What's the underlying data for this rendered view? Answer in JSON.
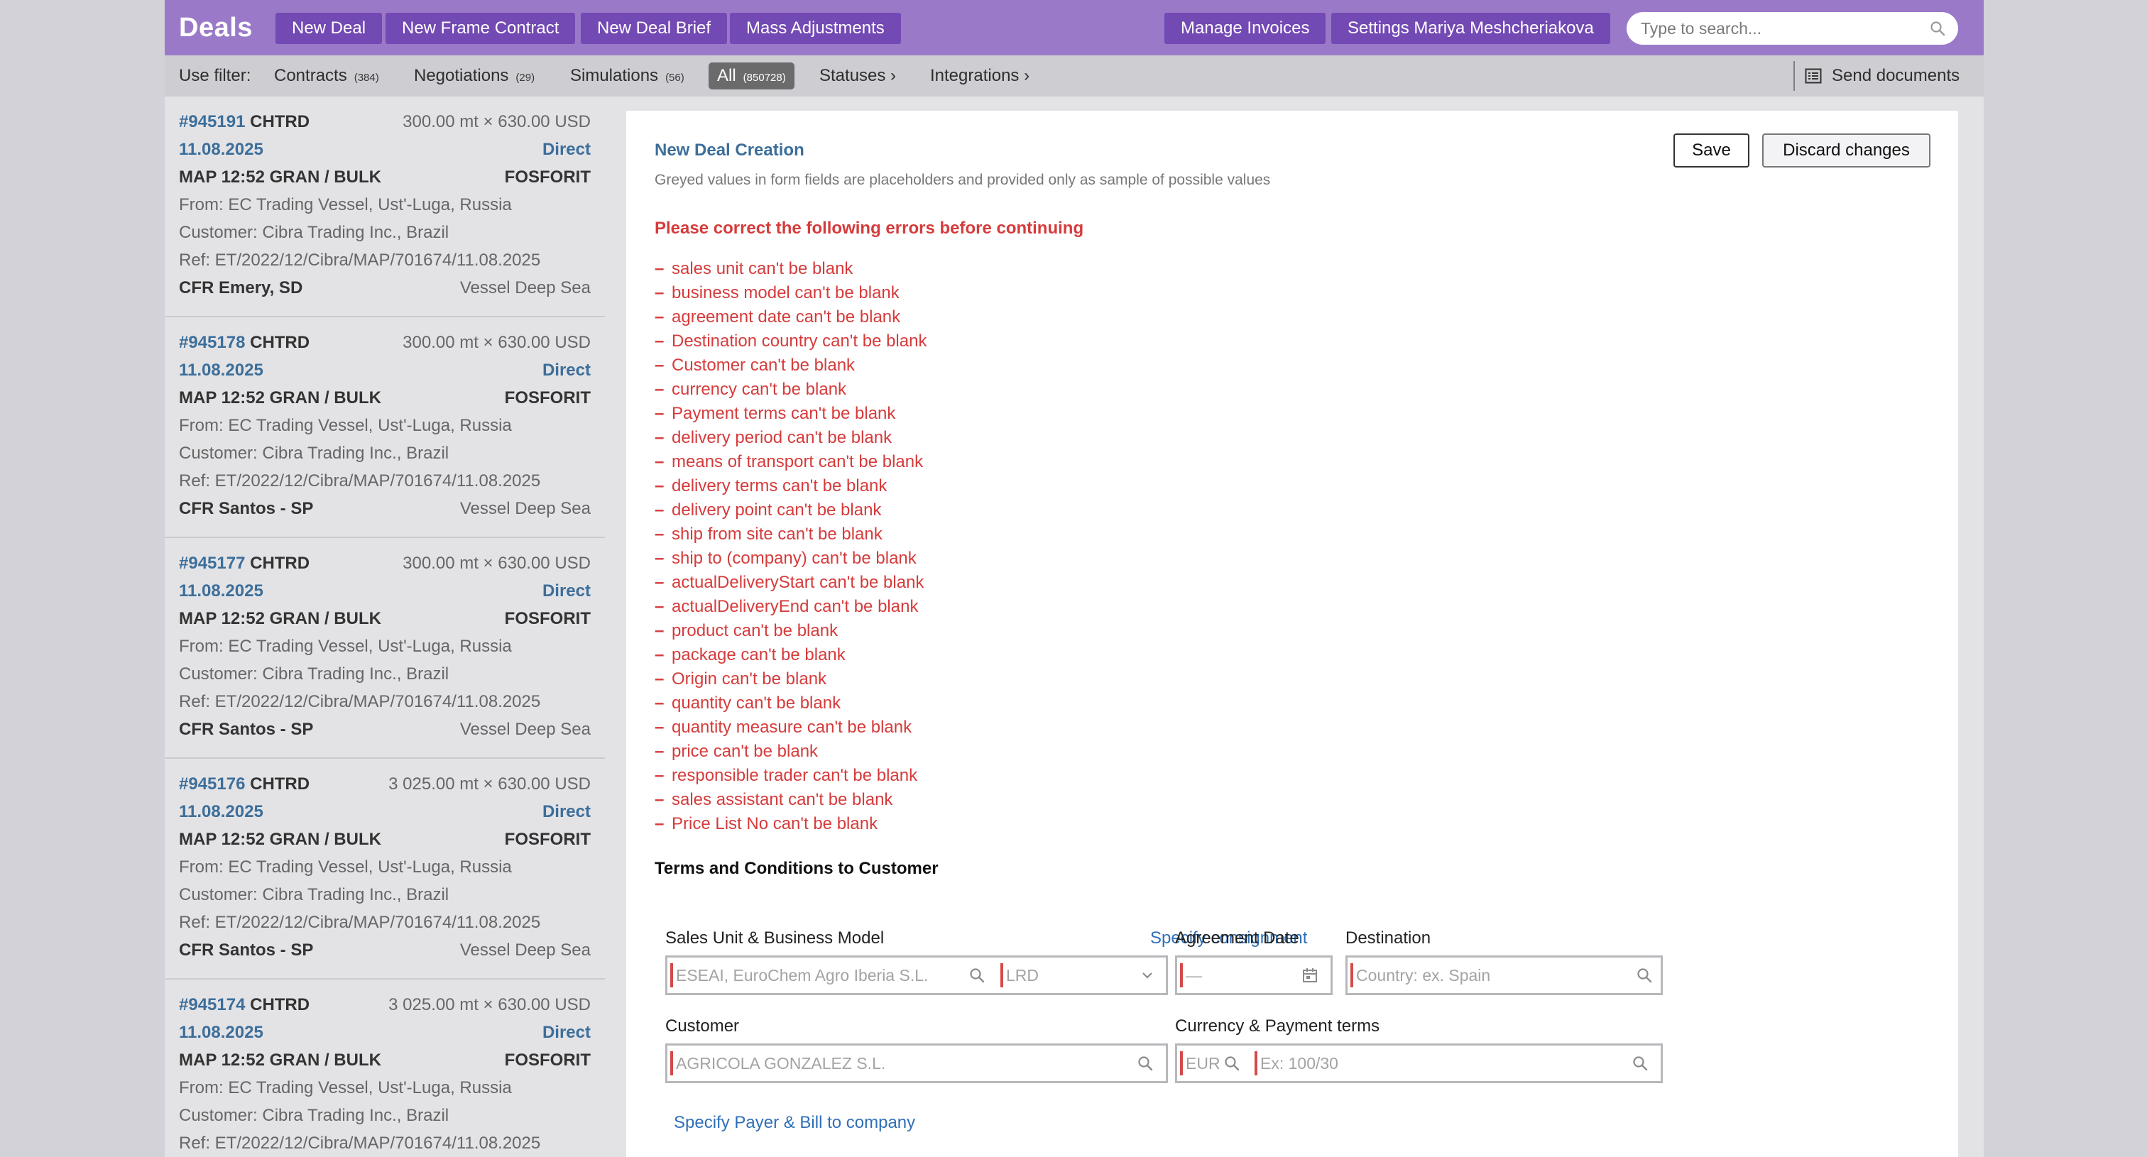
{
  "topbar": {
    "brand": "Deals",
    "left_buttons": [
      "New Deal",
      "New Frame Contract",
      "New Deal Brief",
      "Mass Adjustments"
    ],
    "manage_invoices": "Manage Invoices",
    "settings_user": "Settings Mariya Meshcheriakova",
    "search_placeholder": "Type to search..."
  },
  "filterbar": {
    "use_filter_label": "Use filter:",
    "filters": [
      {
        "label": "Contracts",
        "count": "(384)"
      },
      {
        "label": "Negotiations",
        "count": "(29)"
      },
      {
        "label": "Simulations",
        "count": "(56)"
      },
      {
        "label": "All",
        "count": "(850728)",
        "active": true
      }
    ],
    "statuses": "Statuses ›",
    "integrations": "Integrations ›",
    "send_documents": "Send documents"
  },
  "deals": [
    {
      "id": "#945191",
      "type": "CHTRD",
      "qty_price": "300.00 mt × 630.00 USD",
      "date": "11.08.2025",
      "channel": "Direct",
      "product": "MAP 12:52 GRAN / BULK",
      "company": "FOSFORIT",
      "from": "From: EC Trading Vessel, Ust'-Luga, Russia",
      "customer": "Customer: Cibra Trading Inc., Brazil",
      "ref": "Ref: ET/2022/12/Cibra/MAP/701674/11.08.2025",
      "delivery": "CFR Emery, SD",
      "transport": "Vessel Deep Sea"
    },
    {
      "id": "#945178",
      "type": "CHTRD",
      "qty_price": "300.00 mt × 630.00 USD",
      "date": "11.08.2025",
      "channel": "Direct",
      "product": "MAP 12:52 GRAN / BULK",
      "company": "FOSFORIT",
      "from": "From: EC Trading Vessel, Ust'-Luga, Russia",
      "customer": "Customer: Cibra Trading Inc., Brazil",
      "ref": "Ref: ET/2022/12/Cibra/MAP/701674/11.08.2025",
      "delivery": "CFR Santos - SP",
      "transport": "Vessel Deep Sea"
    },
    {
      "id": "#945177",
      "type": "CHTRD",
      "qty_price": "300.00 mt × 630.00 USD",
      "date": "11.08.2025",
      "channel": "Direct",
      "product": "MAP 12:52 GRAN / BULK",
      "company": "FOSFORIT",
      "from": "From: EC Trading Vessel, Ust'-Luga, Russia",
      "customer": "Customer: Cibra Trading Inc., Brazil",
      "ref": "Ref: ET/2022/12/Cibra/MAP/701674/11.08.2025",
      "delivery": "CFR Santos - SP",
      "transport": "Vessel Deep Sea"
    },
    {
      "id": "#945176",
      "type": "CHTRD",
      "qty_price": "3 025.00 mt × 630.00 USD",
      "date": "11.08.2025",
      "channel": "Direct",
      "product": "MAP 12:52 GRAN / BULK",
      "company": "FOSFORIT",
      "from": "From: EC Trading Vessel, Ust'-Luga, Russia",
      "customer": "Customer: Cibra Trading Inc., Brazil",
      "ref": "Ref: ET/2022/12/Cibra/MAP/701674/11.08.2025",
      "delivery": "CFR Santos - SP",
      "transport": "Vessel Deep Sea"
    },
    {
      "id": "#945174",
      "type": "CHTRD",
      "qty_price": "3 025.00 mt × 630.00 USD",
      "date": "11.08.2025",
      "channel": "Direct",
      "product": "MAP 12:52 GRAN / BULK",
      "company": "FOSFORIT",
      "from": "From: EC Trading Vessel, Ust'-Luga, Russia",
      "customer": "Customer: Cibra Trading Inc., Brazil",
      "ref": "Ref: ET/2022/12/Cibra/MAP/701674/11.08.2025",
      "delivery": "",
      "transport": ""
    }
  ],
  "form": {
    "title": "New Deal Creation",
    "subtitle": "Greyed values in form fields are placeholders and provided only as sample of possible values",
    "save": "Save",
    "discard": "Discard changes",
    "error_heading": "Please correct the following errors before continuing",
    "error_dash": "–",
    "errors": [
      "sales unit can't be blank",
      "business model can't be blank",
      "agreement date can't be blank",
      "Destination country can't be blank",
      "Customer can't be blank",
      "currency can't be blank",
      "Payment terms can't be blank",
      "delivery period can't be blank",
      "means of transport can't be blank",
      "delivery terms can't be blank",
      "delivery point can't be blank",
      "ship from site can't be blank",
      "ship to (company) can't be blank",
      "actualDeliveryStart can't be blank",
      "actualDeliveryEnd can't be blank",
      "product can't be blank",
      "package can't be blank",
      "Origin can't be blank",
      "quantity can't be blank",
      "quantity measure can't be blank",
      "price can't be blank",
      "responsible trader can't be blank",
      "sales assistant can't be blank",
      "Price List No can't be blank"
    ],
    "section_title": "Terms and Conditions to Customer",
    "sales_unit_label": "Sales Unit & Business Model",
    "specify_consignment": "Specify consignment",
    "sales_unit_placeholder": "ESEAI, EuroChem Agro Iberia S.L.",
    "business_model_placeholder": "LRD",
    "agreement_date_label": "Agreement Date",
    "agreement_date_placeholder": "—",
    "destination_label": "Destination",
    "destination_placeholder": "Country: ex. Spain",
    "customer_label": "Customer",
    "customer_placeholder": "AGRICOLA GONZALEZ S.L.",
    "currency_label": "Currency & Payment terms",
    "currency_placeholder": "EUR",
    "payment_terms_placeholder": "Ex: 100/30",
    "specify_payer": "Specify Payer & Bill to company"
  },
  "colors": {
    "topbar": "#9a7ac8",
    "button": "#7349b4",
    "link": "#2f6fb7",
    "error": "#d63b3b",
    "deal_id": "#3c6e9a"
  }
}
